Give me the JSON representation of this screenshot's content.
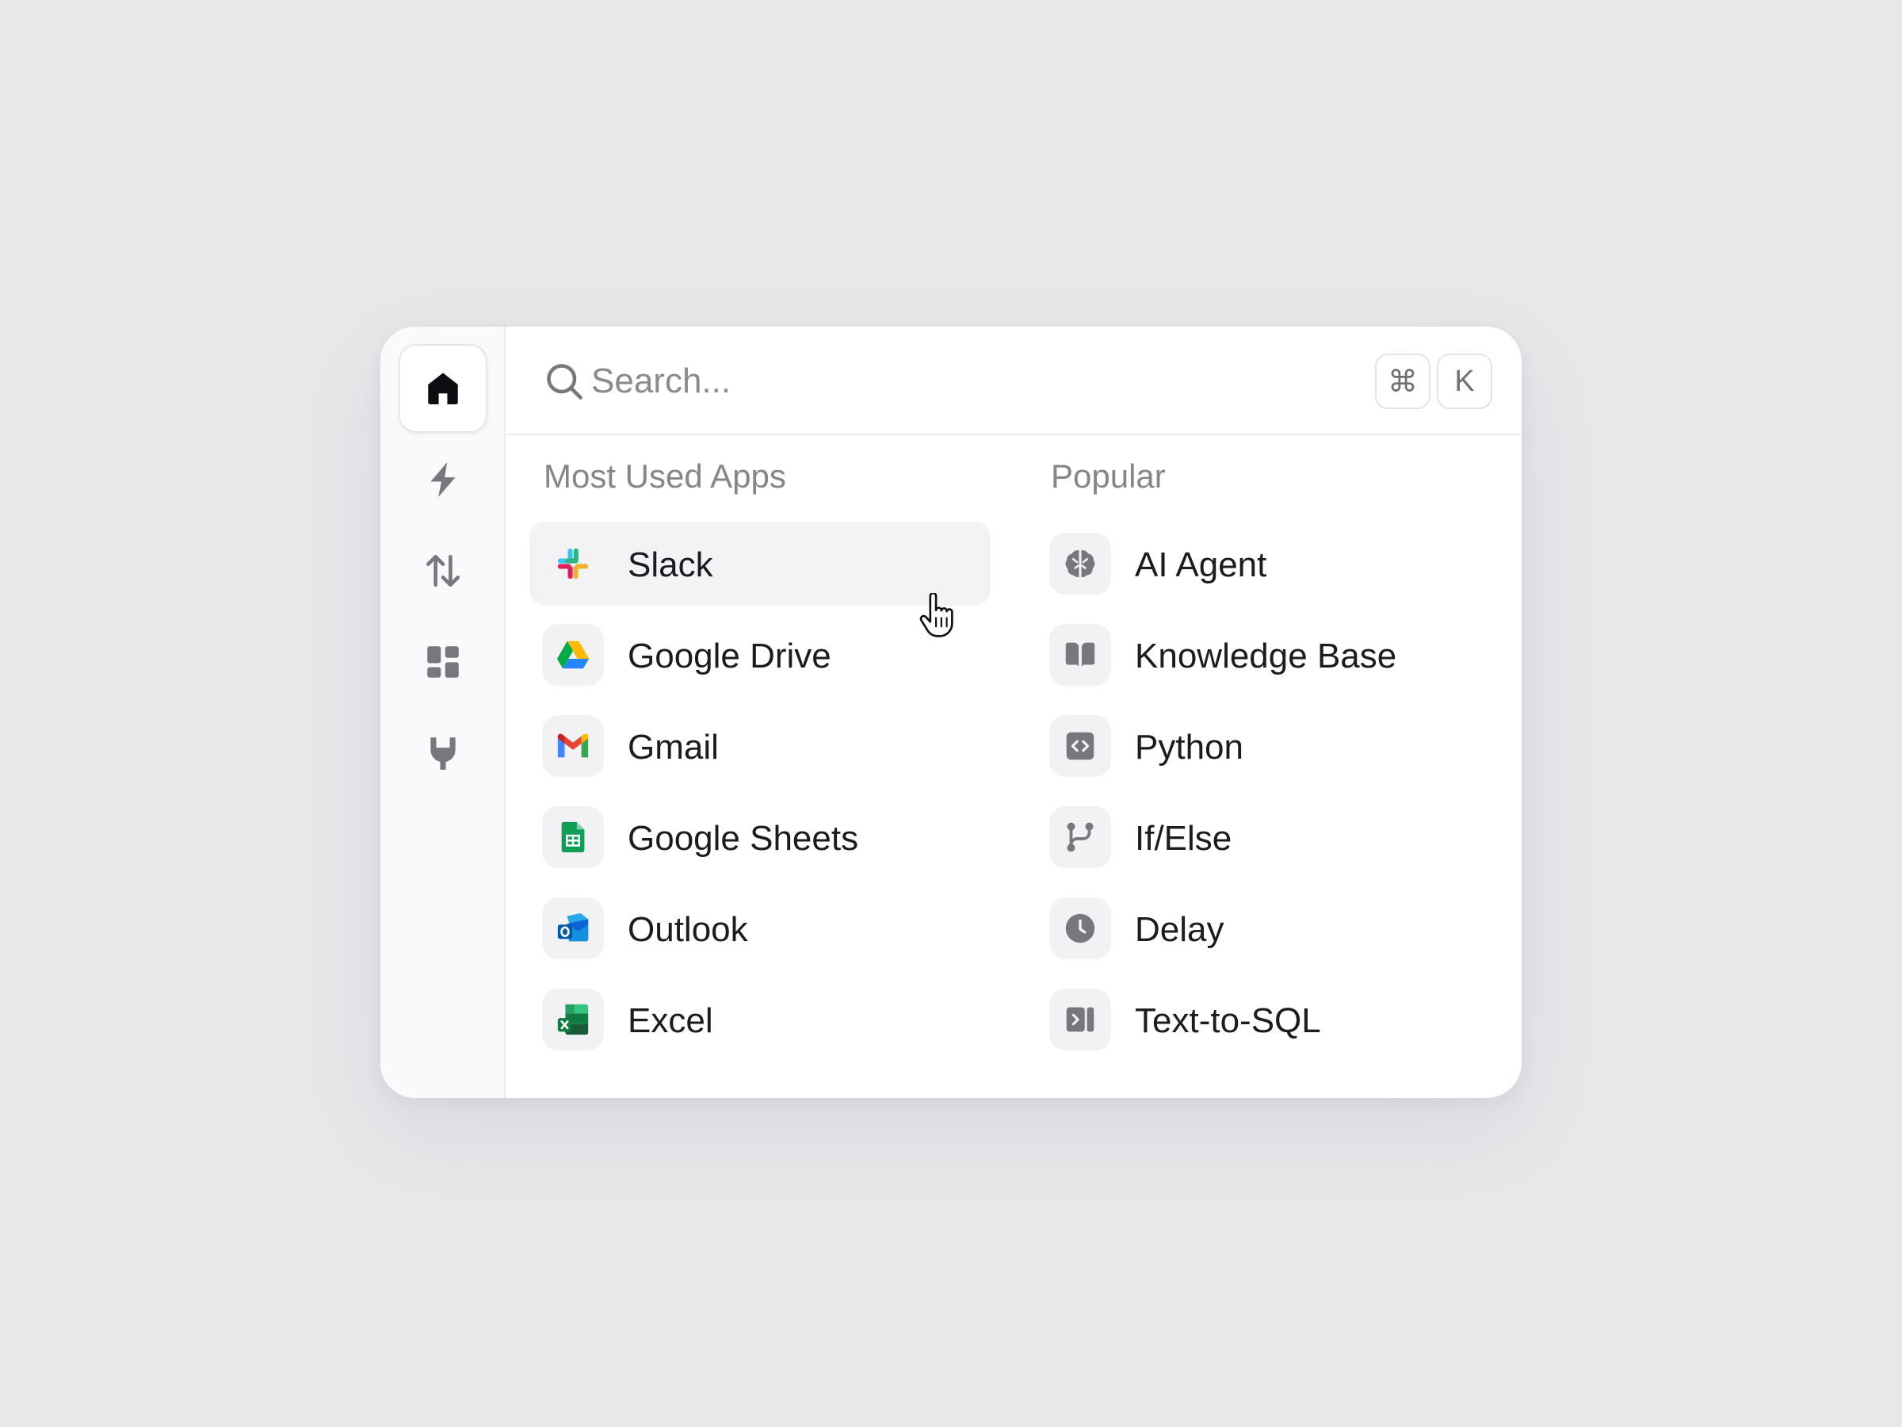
{
  "search": {
    "placeholder": "Search...",
    "shortcut_cmd": "⌘",
    "shortcut_key": "K"
  },
  "sidebar": {
    "items": [
      {
        "icon": "home-icon",
        "active": true
      },
      {
        "icon": "bolt-icon",
        "active": false
      },
      {
        "icon": "arrows-up-down-icon",
        "active": false
      },
      {
        "icon": "dashboard-icon",
        "active": false
      },
      {
        "icon": "plug-icon",
        "active": false
      }
    ]
  },
  "most_used": {
    "title": "Most Used Apps",
    "items": [
      {
        "label": "Slack",
        "icon": "slack-icon"
      },
      {
        "label": "Google Drive",
        "icon": "google-drive-icon"
      },
      {
        "label": "Gmail",
        "icon": "gmail-icon"
      },
      {
        "label": "Google Sheets",
        "icon": "google-sheets-icon"
      },
      {
        "label": "Outlook",
        "icon": "outlook-icon"
      },
      {
        "label": "Excel",
        "icon": "excel-icon"
      }
    ]
  },
  "popular": {
    "title": "Popular",
    "items": [
      {
        "label": "AI Agent",
        "icon": "brain-icon"
      },
      {
        "label": "Knowledge Base",
        "icon": "book-icon"
      },
      {
        "label": "Python",
        "icon": "code-icon"
      },
      {
        "label": "If/Else",
        "icon": "branch-icon"
      },
      {
        "label": "Delay",
        "icon": "clock-icon"
      },
      {
        "label": "Text-to-SQL",
        "icon": "text-to-sql-icon"
      }
    ]
  },
  "colors": {
    "background": "#e8e7ea",
    "panel": "#ffffff",
    "hover_row": "#f3f3f6",
    "muted_text": "#85858c",
    "icon_gray": "#77777d"
  }
}
